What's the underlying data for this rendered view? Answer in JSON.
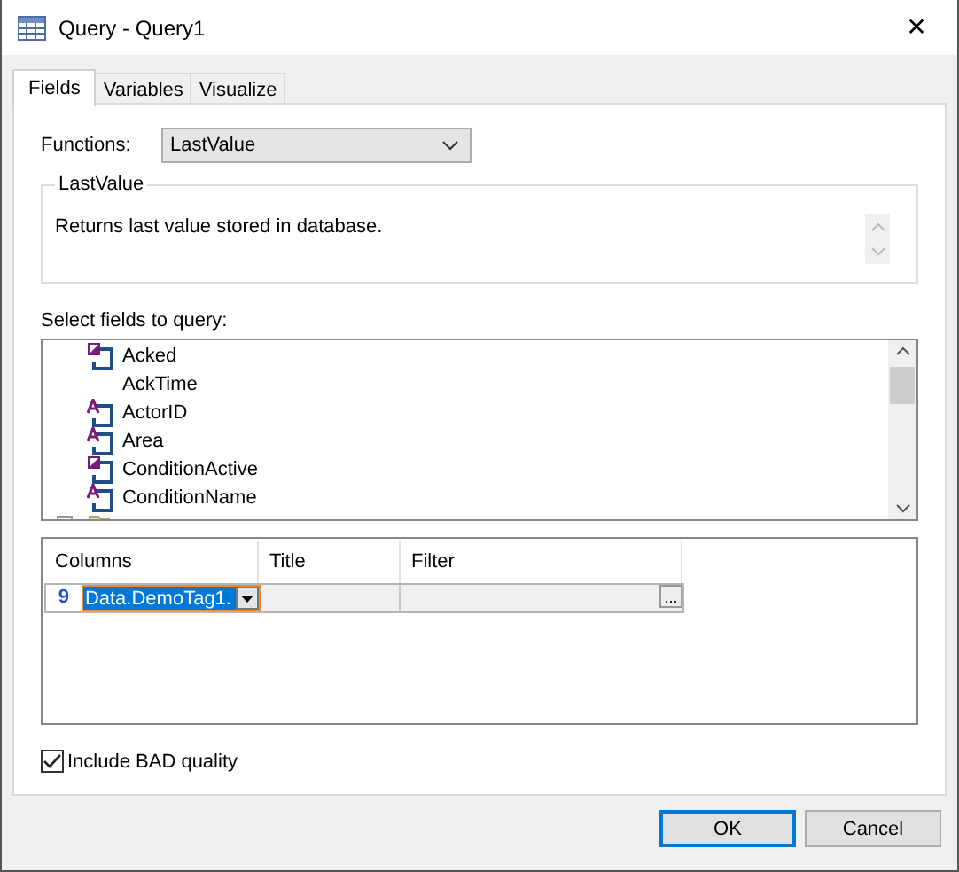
{
  "window": {
    "title": "Query - Query1",
    "close": "✕"
  },
  "tabs": [
    {
      "label": "Fields",
      "selected": true
    },
    {
      "label": "Variables",
      "selected": false
    },
    {
      "label": "Visualize",
      "selected": false
    }
  ],
  "functions": {
    "label": "Functions:",
    "value": "LastValue"
  },
  "description": {
    "legend": "LastValue",
    "text": "Returns last value stored in database."
  },
  "fields": {
    "label": "Select fields to query:",
    "items": [
      {
        "kind": "bool",
        "name": "Acked"
      },
      {
        "kind": "plain",
        "name": "AckTime"
      },
      {
        "kind": "text",
        "name": "ActorID"
      },
      {
        "kind": "text",
        "name": "Area"
      },
      {
        "kind": "bool",
        "name": "ConditionActive"
      },
      {
        "kind": "text",
        "name": "ConditionName"
      },
      {
        "kind": "folder"
      }
    ]
  },
  "grid": {
    "columns": [
      "Columns",
      "Title",
      "Filter"
    ],
    "rows": [
      {
        "marker": "9",
        "column": "Data.DemoTag1.",
        "title": "",
        "filter_button": "..."
      }
    ]
  },
  "include_bad": {
    "label": "Include BAD quality",
    "checked": true
  },
  "buttons": [
    {
      "label": "OK",
      "default": true
    },
    {
      "label": "Cancel",
      "default": false
    }
  ]
}
